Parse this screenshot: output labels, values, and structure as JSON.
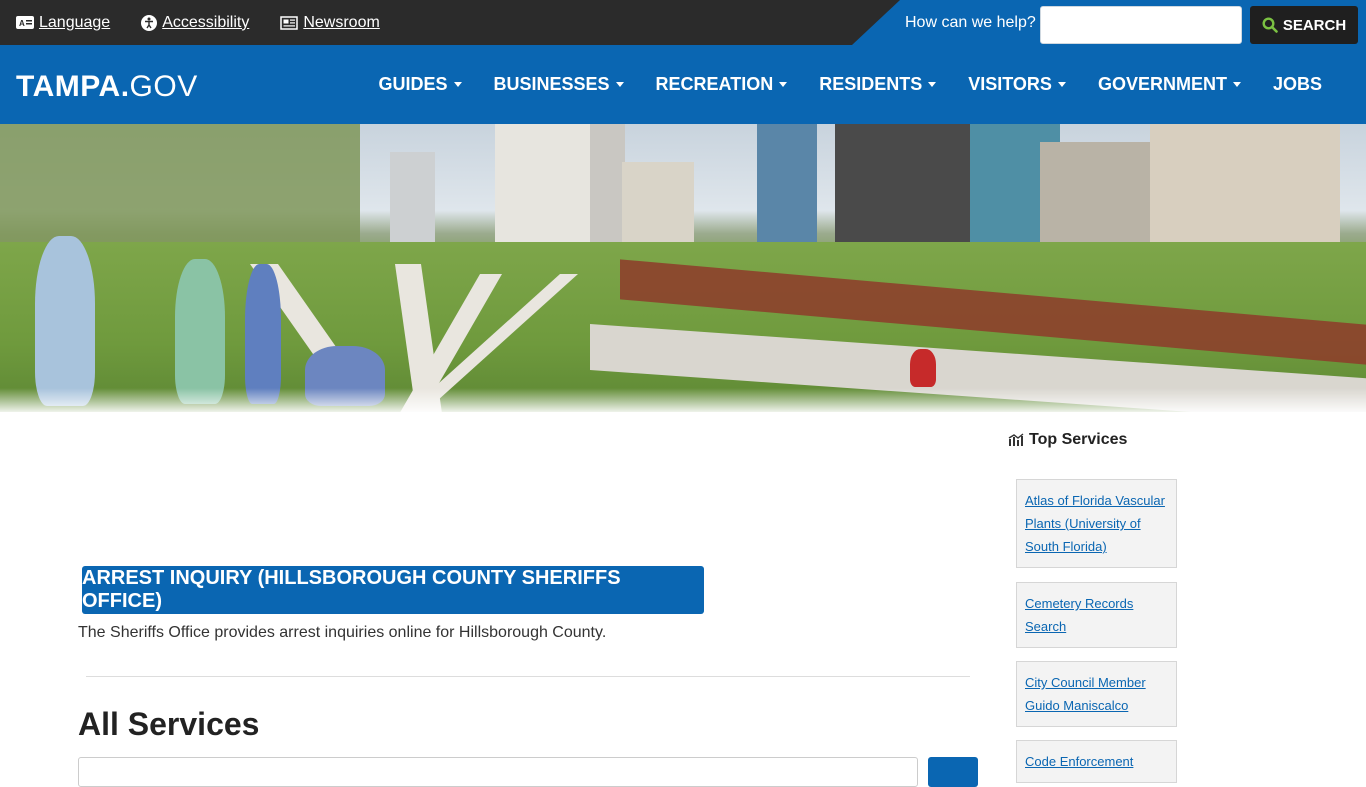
{
  "utility": {
    "links": [
      {
        "label": "Language",
        "icon": "language-icon"
      },
      {
        "label": "Accessibility",
        "icon": "accessibility-icon"
      },
      {
        "label": "Newsroom",
        "icon": "newsroom-icon"
      }
    ],
    "help_label": "How can we help?",
    "search_value": "",
    "search_button": "SEARCH"
  },
  "header": {
    "logo_bold": "TAMPA.",
    "logo_thin": "GOV",
    "nav": [
      {
        "label": "GUIDES",
        "dropdown": true
      },
      {
        "label": "BUSINESSES",
        "dropdown": true
      },
      {
        "label": "RECREATION",
        "dropdown": true
      },
      {
        "label": "RESIDENTS",
        "dropdown": true
      },
      {
        "label": "VISITORS",
        "dropdown": true
      },
      {
        "label": "GOVERNMENT",
        "dropdown": true
      },
      {
        "label": "JOBS",
        "dropdown": false
      }
    ]
  },
  "main": {
    "service_button": "ARREST INQUIRY (HILLSBOROUGH COUNTY SHERIFFS OFFICE)",
    "service_description": "The Sheriffs Office provides arrest inquiries online for Hillsborough County.",
    "all_services_heading": "All Services"
  },
  "sidebar": {
    "heading": "Top Services",
    "items": [
      {
        "label": "Atlas of Florida Vascular Plants (University of South Florida)"
      },
      {
        "label": "Cemetery Records Search"
      },
      {
        "label": "City Council Member Guido Maniscalco"
      },
      {
        "label": "Code Enforcement"
      }
    ]
  },
  "colors": {
    "brand_blue": "#0a66b2",
    "topbar_dark": "#2b2b2b",
    "search_button_bg": "#1f1f1f",
    "search_icon": "#7bc142"
  }
}
